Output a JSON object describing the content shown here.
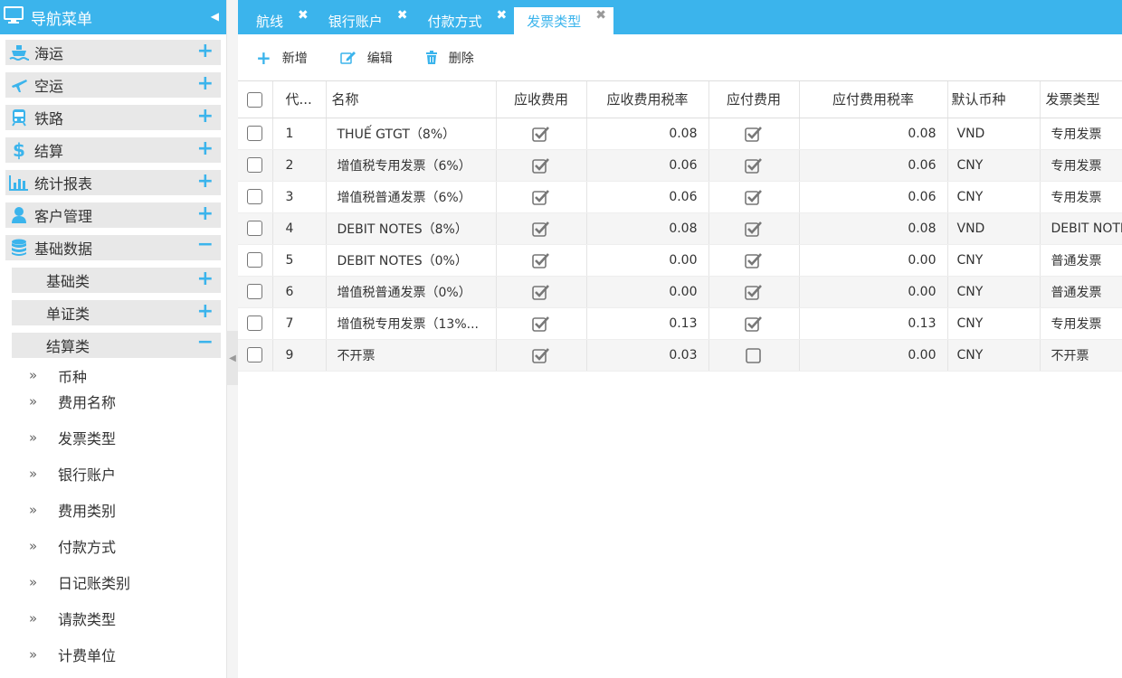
{
  "sidebar": {
    "title": "导航菜单",
    "menu": [
      {
        "label": "海运",
        "icon": "ship-icon",
        "expanded": false
      },
      {
        "label": "空运",
        "icon": "plane-icon",
        "expanded": false
      },
      {
        "label": "铁路",
        "icon": "train-icon",
        "expanded": false
      },
      {
        "label": "结算",
        "icon": "dollar-icon",
        "expanded": false
      },
      {
        "label": "统计报表",
        "icon": "bar-chart-icon",
        "expanded": false
      },
      {
        "label": "客户管理",
        "icon": "user-icon",
        "expanded": false
      },
      {
        "label": "基础数据",
        "icon": "database-icon",
        "expanded": true
      }
    ],
    "submenu": [
      {
        "label": "基础类",
        "expanded": false
      },
      {
        "label": "单证类",
        "expanded": false
      },
      {
        "label": "结算类",
        "expanded": true
      }
    ],
    "leaves": [
      "币种",
      "费用名称",
      "发票类型",
      "银行账户",
      "费用类别",
      "付款方式",
      "日记账类别",
      "请款类型",
      "计费单位"
    ]
  },
  "tabs": [
    {
      "label": "航线",
      "active": false
    },
    {
      "label": "银行账户",
      "active": false
    },
    {
      "label": "付款方式",
      "active": false
    },
    {
      "label": "发票类型",
      "active": true
    }
  ],
  "toolbar": {
    "add_label": "新增",
    "edit_label": "编辑",
    "delete_label": "删除"
  },
  "table": {
    "columns": {
      "code": "代...",
      "name": "名称",
      "recv": "应收费用",
      "recv_rate": "应收费用税率",
      "pay": "应付费用",
      "pay_rate": "应付费用税率",
      "currency": "默认币种",
      "invoice_type": "发票类型"
    },
    "rows": [
      {
        "code": "1",
        "name": "THUẾ GTGT（8%）",
        "recv": true,
        "recv_rate": "0.08",
        "pay": true,
        "pay_rate": "0.08",
        "currency": "VND",
        "invoice_type": "专用发票"
      },
      {
        "code": "2",
        "name": "增值税专用发票（6%）",
        "recv": true,
        "recv_rate": "0.06",
        "pay": true,
        "pay_rate": "0.06",
        "currency": "CNY",
        "invoice_type": "专用发票"
      },
      {
        "code": "3",
        "name": "增值税普通发票（6%）",
        "recv": true,
        "recv_rate": "0.06",
        "pay": true,
        "pay_rate": "0.06",
        "currency": "CNY",
        "invoice_type": "专用发票"
      },
      {
        "code": "4",
        "name": "DEBIT NOTES（8%）",
        "recv": true,
        "recv_rate": "0.08",
        "pay": true,
        "pay_rate": "0.08",
        "currency": "VND",
        "invoice_type": "DEBIT NOTES"
      },
      {
        "code": "5",
        "name": "DEBIT NOTES（0%）",
        "recv": true,
        "recv_rate": "0.00",
        "pay": true,
        "pay_rate": "0.00",
        "currency": "CNY",
        "invoice_type": "普通发票"
      },
      {
        "code": "6",
        "name": "增值税普通发票（0%）",
        "recv": true,
        "recv_rate": "0.00",
        "pay": true,
        "pay_rate": "0.00",
        "currency": "CNY",
        "invoice_type": "普通发票"
      },
      {
        "code": "7",
        "name": "增值税专用发票（13%...",
        "recv": true,
        "recv_rate": "0.13",
        "pay": true,
        "pay_rate": "0.13",
        "currency": "CNY",
        "invoice_type": "专用发票"
      },
      {
        "code": "9",
        "name": "不开票",
        "recv": true,
        "recv_rate": "0.03",
        "pay": false,
        "pay_rate": "0.00",
        "currency": "CNY",
        "invoice_type": "不开票"
      }
    ]
  },
  "colors": {
    "accent": "#3bb4ec",
    "menu_bg": "#e8e8e8",
    "row_alt": "#f5f5f5"
  }
}
